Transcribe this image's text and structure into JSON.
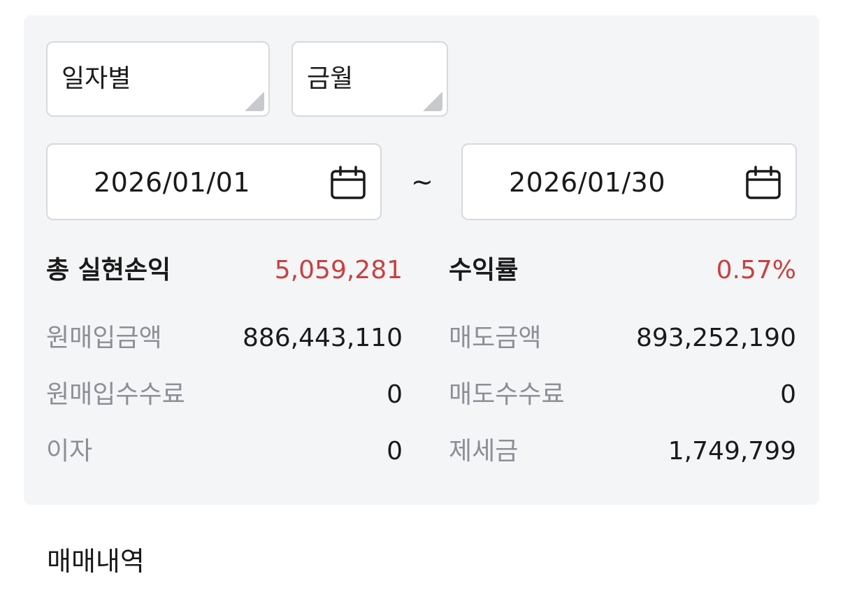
{
  "filters": {
    "period_type": "일자별",
    "month": "금월"
  },
  "date_range": {
    "start": "2026/01/01",
    "separator": "~",
    "end": "2026/01/30"
  },
  "summary": {
    "total_realized_pnl_label": "총 실현손익",
    "total_realized_pnl_value": "5,059,281",
    "return_rate_label": "수익률",
    "return_rate_value": "0.57%",
    "purchase_amount_label": "원매입금액",
    "purchase_amount_value": "886,443,110",
    "sell_amount_label": "매도금액",
    "sell_amount_value": "893,252,190",
    "purchase_fee_label": "원매입수수료",
    "purchase_fee_value": "0",
    "sell_fee_label": "매도수수료",
    "sell_fee_value": "0",
    "interest_label": "이자",
    "interest_value": "0",
    "taxes_label": "제세금",
    "taxes_value": "1,749,799"
  },
  "section": {
    "trade_history_title": "매매내역"
  },
  "colors": {
    "accent_red": "#c94040",
    "panel_bg": "#f4f5f7",
    "muted_text": "#8b8f96"
  },
  "icons": {
    "calendar": "calendar-icon",
    "dropdown_corner": "dropdown-corner-icon"
  }
}
